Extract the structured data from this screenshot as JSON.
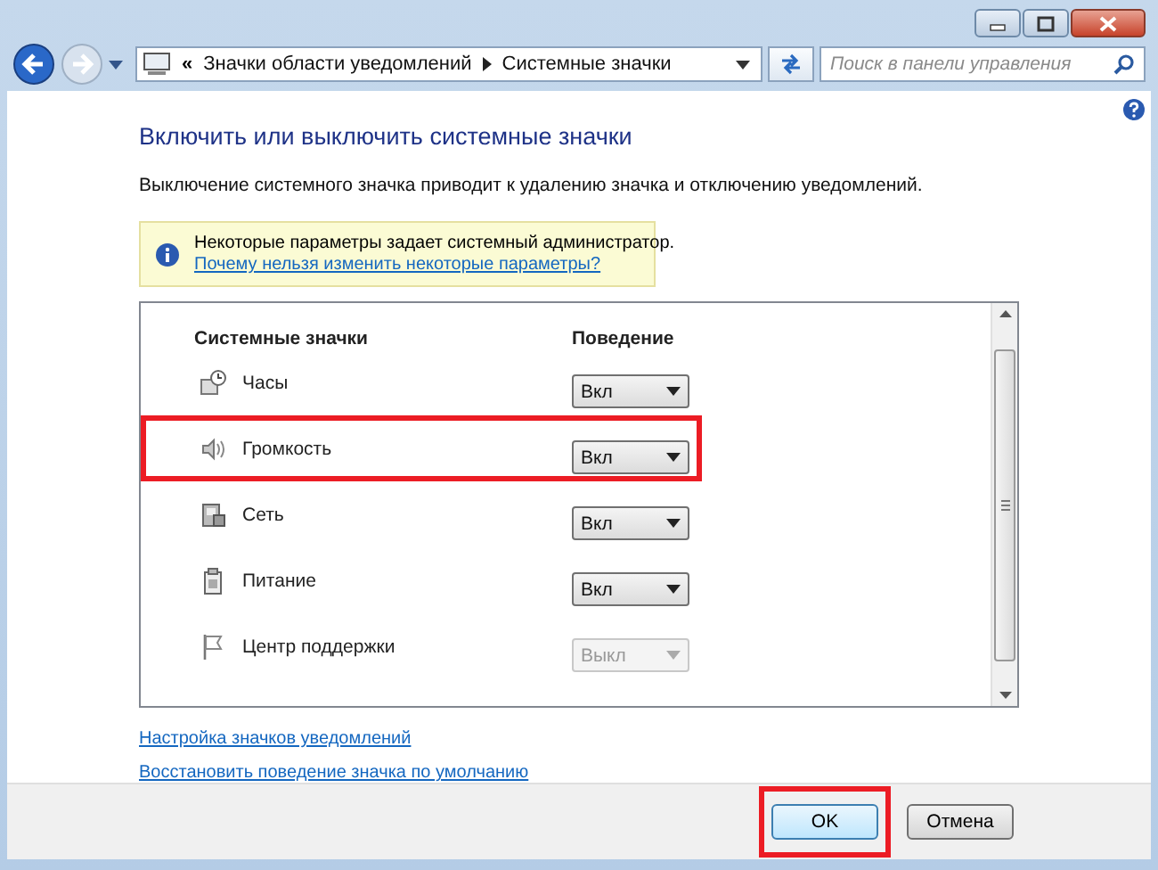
{
  "address_bar": {
    "breadcrumbs": [
      "Значки области уведомлений",
      "Системные значки"
    ],
    "overflow": "«"
  },
  "search": {
    "placeholder": "Поиск в панели управления"
  },
  "heading": "Включить или выключить системные значки",
  "description": "Выключение системного значка приводит к удалению значка и отключению уведомлений.",
  "notice": {
    "text": "Некоторые параметры задает системный администратор.",
    "link": "Почему нельзя изменить некоторые параметры?"
  },
  "table": {
    "columns": [
      "Системные значки",
      "Поведение"
    ],
    "rows": [
      {
        "name": "Часы",
        "value": "Вкл",
        "disabled": false,
        "highlighted": false
      },
      {
        "name": "Громкость",
        "value": "Вкл",
        "disabled": false,
        "highlighted": true
      },
      {
        "name": "Сеть",
        "value": "Вкл",
        "disabled": false,
        "highlighted": false
      },
      {
        "name": "Питание",
        "value": "Вкл",
        "disabled": false,
        "highlighted": false
      },
      {
        "name": "Центр поддержки",
        "value": "Выкл",
        "disabled": true,
        "highlighted": false
      }
    ]
  },
  "links": [
    "Настройка значков уведомлений",
    "Восстановить поведение значка по умолчанию"
  ],
  "buttons": [
    {
      "label": "OK",
      "highlighted": true
    },
    {
      "label": "Отмена",
      "highlighted": false
    }
  ]
}
